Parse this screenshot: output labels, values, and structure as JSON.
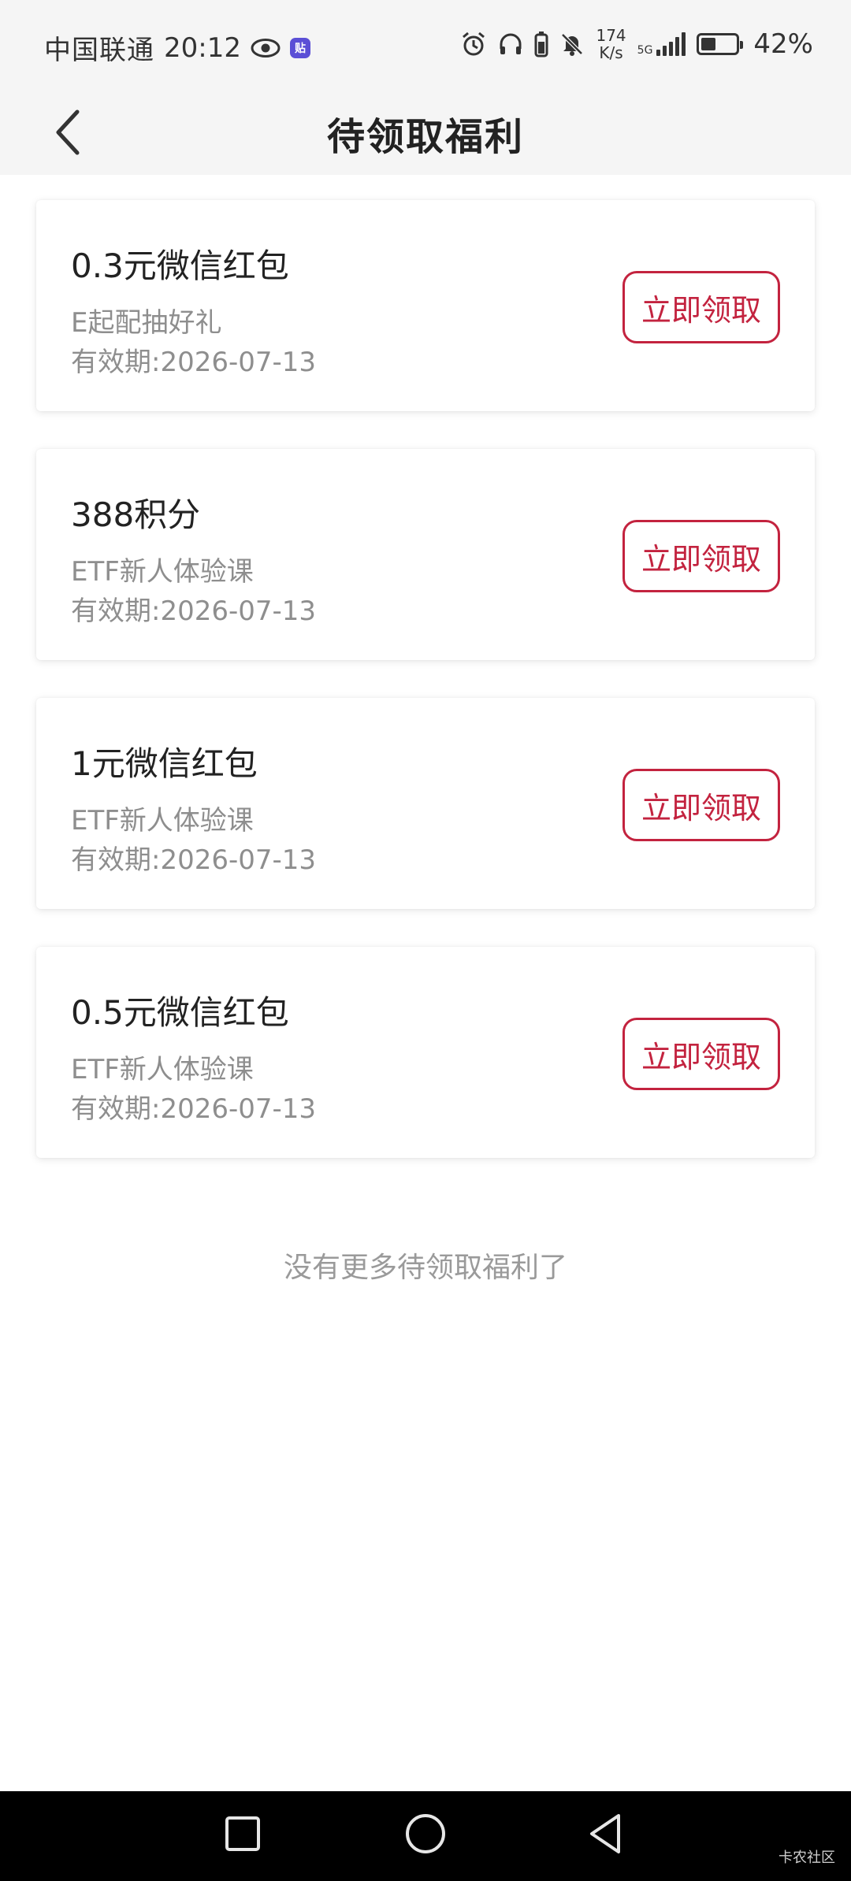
{
  "status_bar": {
    "carrier": "中国联通",
    "time": "20:12",
    "speed_value": "174",
    "speed_unit": "K/s",
    "network": "5G",
    "battery_percent": "42%",
    "battery_level": 0.42
  },
  "header": {
    "title": "待领取福利"
  },
  "cards": [
    {
      "title": "0.3元微信红包",
      "subtitle": "E起配抽好礼",
      "expiry": "有效期:2026-07-13",
      "button": "立即领取"
    },
    {
      "title": "388积分",
      "subtitle": "ETF新人体验课",
      "expiry": "有效期:2026-07-13",
      "button": "立即领取"
    },
    {
      "title": "1元微信红包",
      "subtitle": "ETF新人体验课",
      "expiry": "有效期:2026-07-13",
      "button": "立即领取"
    },
    {
      "title": "0.5元微信红包",
      "subtitle": "ETF新人体验课",
      "expiry": "有效期:2026-07-13",
      "button": "立即领取"
    }
  ],
  "footer_text": "没有更多待领取福利了",
  "watermark": "卡农社区",
  "colors": {
    "accent": "#c3233f",
    "header_bg": "#f5f5f5"
  }
}
